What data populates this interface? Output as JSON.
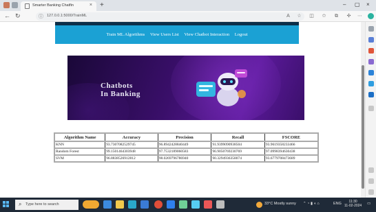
{
  "browser": {
    "tab_title": "Smarter Banking Chatfin",
    "tab_close": "×",
    "new_tab": "+",
    "url": "127.0.0.1:5000/TrainML",
    "window_controls": {
      "minimize": "–",
      "maximize": "▢",
      "close": "×"
    }
  },
  "navigation": {
    "links": [
      "Train ML Algorithms",
      "View Users List",
      "View Chatbot Interaction",
      "Logout"
    ]
  },
  "banner": {
    "line1": "Chatbots",
    "line2": "In Banking"
  },
  "table": {
    "headers": [
      "Algorithm Name",
      "Accuracy",
      "Precision",
      "Recall",
      "FSCORE"
    ],
    "rows": [
      [
        "KNN",
        "93.7307082529745",
        "96.8942428840449",
        "91.9399090938504",
        "93.9619358233466"
      ],
      [
        "Random Forest",
        "99.1501464303948",
        "97.7532189060583",
        "96.9050769230769",
        "97.0998394630438"
      ],
      [
        "SVM",
        "96.8838526912812",
        "98.0269796786940",
        "90.3294936358074",
        "93.6779708473689"
      ]
    ]
  },
  "taskbar": {
    "search_placeholder": "Type here to search",
    "weather": "33°C  Mostly sunny",
    "lang": "ENG",
    "time": "11:30",
    "date": "11-02-2024"
  },
  "colors": {
    "nav_band": "#1ba1d4",
    "top_strip": "#0c2f49",
    "banner_dark": "#1a0838",
    "banner_purple": "#5b1a9a",
    "taskbar": "#1f2a38"
  },
  "icons": [
    "search-icon",
    "back-icon",
    "refresh-icon",
    "info-icon",
    "star-icon",
    "extensions-icon",
    "windows-start-icon"
  ]
}
